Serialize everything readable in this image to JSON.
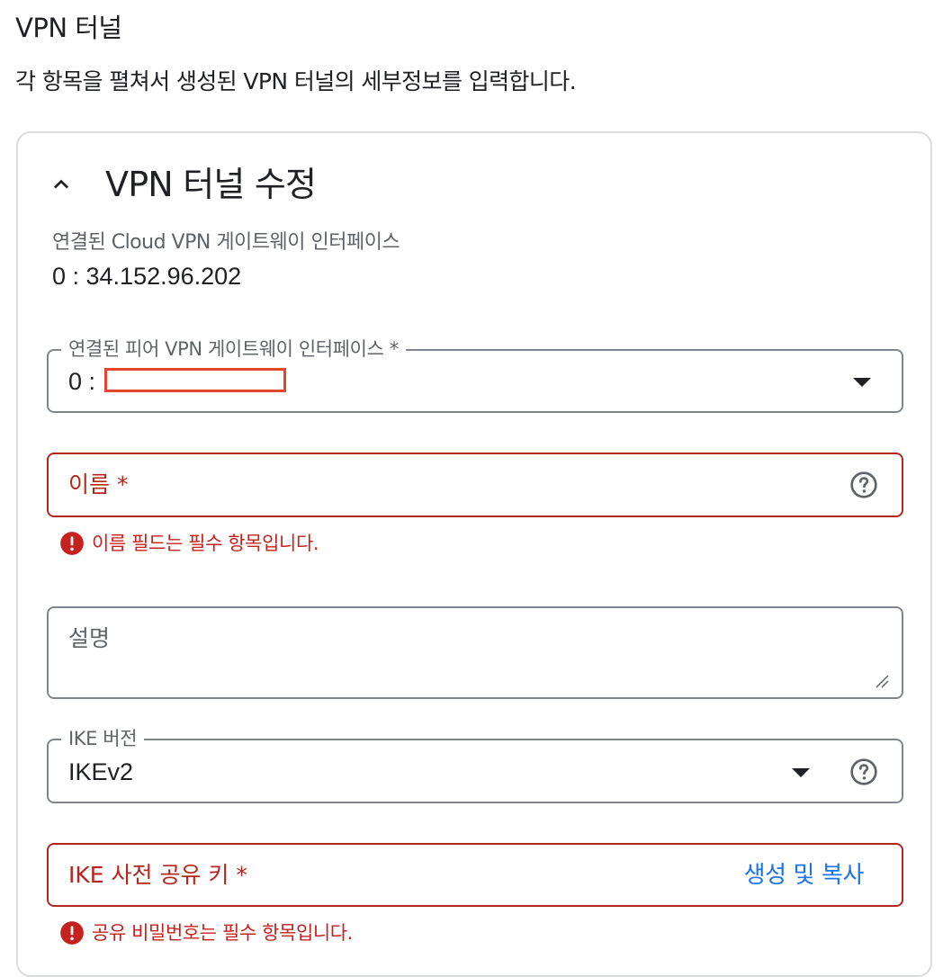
{
  "section": {
    "title": "VPN 터널",
    "description": "각 항목을 펼쳐서 생성된 VPN 터널의 세부정보를 입력합니다."
  },
  "tunnel_card": {
    "title": "VPN 터널 수정",
    "expand_icon": "chevron-up-icon",
    "cloud_interface": {
      "label": "연결된 Cloud VPN 게이트웨이 인터페이스",
      "value": "0 : 34.152.96.202"
    },
    "peer_interface": {
      "label": "연결된 피어 VPN 게이트웨이 인터페이스 *",
      "value": "0 :",
      "icon": "dropdown-arrow-icon"
    },
    "name": {
      "placeholder": "이름 *",
      "error": "이름 필드는 필수 항목입니다.",
      "help_icon": "help-icon"
    },
    "description": {
      "placeholder": "설명"
    },
    "ike_version": {
      "label": "IKE 버전",
      "value": "IKEv2"
    },
    "ike_key": {
      "placeholder": "IKE 사전 공유 키 *",
      "action": "생성 및 복사",
      "error": "공유 비밀번호는 필수 항목입니다."
    }
  },
  "colors": {
    "error": "#b3261e",
    "link": "#1a73e8",
    "border": "#80868b",
    "redaction": "#e4462d"
  }
}
